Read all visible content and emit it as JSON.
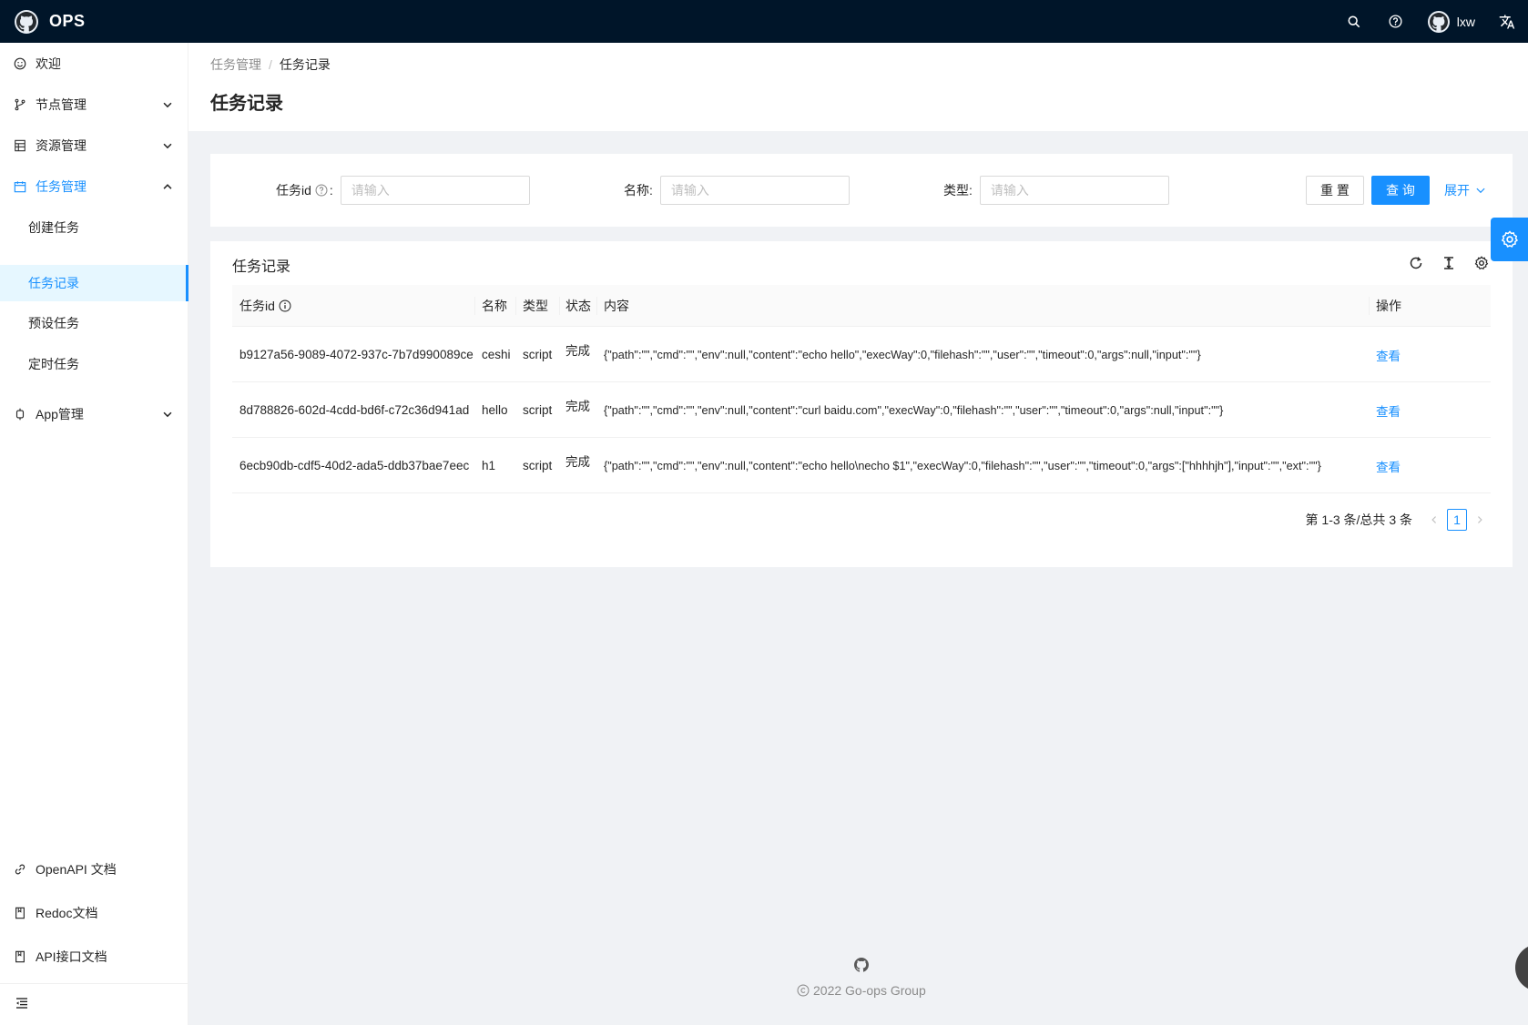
{
  "header": {
    "brand": "OPS",
    "username": "lxw",
    "icons": [
      "github-logo-icon",
      "search-icon",
      "question-icon",
      "avatar-icon",
      "translate-icon"
    ]
  },
  "sidebar": {
    "items": [
      {
        "label": "欢迎",
        "icon": "smile-icon"
      },
      {
        "label": "节点管理",
        "icon": "branch-icon"
      },
      {
        "label": "资源管理",
        "icon": "table-icon"
      },
      {
        "label": "任务管理",
        "icon": "calendar-icon"
      },
      {
        "label": "App管理",
        "icon": "api-icon"
      }
    ],
    "sub_items": [
      {
        "label": "创建任务"
      },
      {
        "label": "任务记录"
      },
      {
        "label": "预设任务"
      },
      {
        "label": "定时任务"
      }
    ],
    "bottom_links": [
      {
        "label": "OpenAPI 文档",
        "icon": "link-icon"
      },
      {
        "label": "Redoc文档",
        "icon": "book-icon"
      },
      {
        "label": "API接口文档",
        "icon": "book-icon"
      }
    ]
  },
  "page": {
    "breadcrumb": [
      "任务管理",
      "任务记录"
    ],
    "title": "任务记录"
  },
  "search": {
    "fields": [
      {
        "label": "任务id",
        "placeholder": "请输入"
      },
      {
        "label": "名称:",
        "placeholder": "请输入"
      },
      {
        "label": "类型:",
        "placeholder": "请输入"
      }
    ],
    "reset_label": "重 置",
    "query_label": "查 询",
    "expand_label": "展开"
  },
  "table": {
    "title": "任务记录",
    "columns": [
      "任务id",
      "名称",
      "类型",
      "状态",
      "内容",
      "操作"
    ],
    "rows": [
      {
        "id": "b9127a56-9089-4072-937c-7b7d990089ce",
        "name": "ceshi",
        "type": "script",
        "status": "完成",
        "content": "{\"path\":\"\",\"cmd\":\"\",\"env\":null,\"content\":\"echo hello\",\"execWay\":0,\"filehash\":\"\",\"user\":\"\",\"timeout\":0,\"args\":null,\"input\":\"\"}",
        "action": "查看"
      },
      {
        "id": "8d788826-602d-4cdd-bd6f-c72c36d941ad",
        "name": "hello",
        "type": "script",
        "status": "完成",
        "content": "{\"path\":\"\",\"cmd\":\"\",\"env\":null,\"content\":\"curl baidu.com\",\"execWay\":0,\"filehash\":\"\",\"user\":\"\",\"timeout\":0,\"args\":null,\"input\":\"\"}",
        "action": "查看"
      },
      {
        "id": "6ecb90db-cdf5-40d2-ada5-ddb37bae7eec",
        "name": "h1",
        "type": "script",
        "status": "完成",
        "content": "{\"path\":\"\",\"cmd\":\"\",\"env\":null,\"content\":\"echo hello\\necho $1\",\"execWay\":0,\"filehash\":\"\",\"user\":\"\",\"timeout\":0,\"args\":[\"hhhhjh\"],\"input\":\"\",\"ext\":\"\"}",
        "action": "查看"
      }
    ],
    "pagination_summary": "第 1-3 条/总共 3 条",
    "current_page": "1"
  },
  "footer": {
    "copyright": "2022 Go-ops Group"
  },
  "colors": {
    "header_bg": "#001529",
    "primary": "#1890ff",
    "page_bg": "#f0f2f5",
    "menu_active_bg": "#e6f7ff"
  }
}
